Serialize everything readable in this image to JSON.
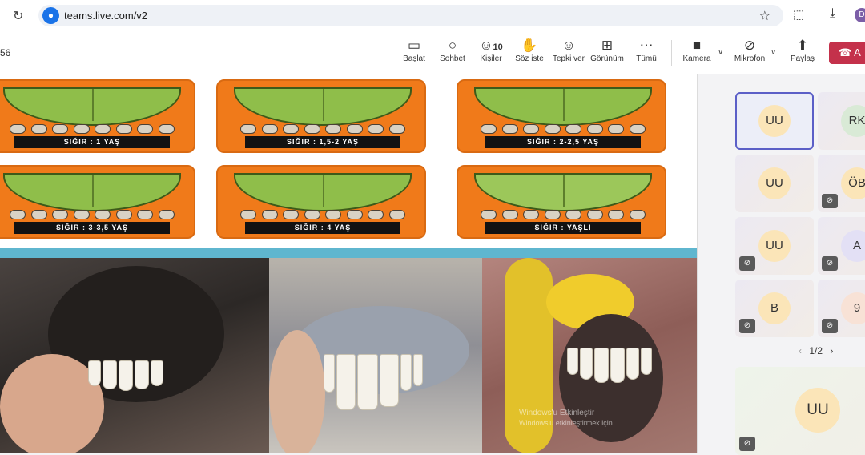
{
  "browser": {
    "url": "teams.live.com/v2",
    "avatar_letter": "D"
  },
  "toolbar": {
    "timer": "56",
    "buttons": [
      {
        "label": "Başlat",
        "icon": "start-icon"
      },
      {
        "label": "Sohbet",
        "icon": "chat-icon"
      },
      {
        "label": "Kişiler",
        "icon": "people-icon",
        "count": "10"
      },
      {
        "label": "Söz iste",
        "icon": "raise-hand-icon"
      },
      {
        "label": "Tepki ver",
        "icon": "react-icon"
      },
      {
        "label": "Görünüm",
        "icon": "view-icon"
      },
      {
        "label": "Tümü",
        "icon": "more-icon"
      },
      {
        "label": "Kamera",
        "icon": "camera-off-icon"
      },
      {
        "label": "Mikrofon",
        "icon": "mic-off-icon"
      },
      {
        "label": "Paylaş",
        "icon": "share-icon"
      }
    ],
    "leave_label": "A",
    "leave_color": "#c4314b"
  },
  "shared_content": {
    "cards": [
      {
        "caption": "SIĞIR : 1 YAŞ"
      },
      {
        "caption": "SIĞIR : 1,5-2 YAŞ"
      },
      {
        "caption": "SIĞIR : 2-2,5 YAŞ"
      },
      {
        "caption": "SIĞIR : 3-3,5 YAŞ"
      },
      {
        "caption": "SIĞIR : 4 YAŞ"
      },
      {
        "caption": "SIĞIR : YAŞLI"
      }
    ],
    "watermark_line1": "Windows'u Etkinleştir",
    "watermark_line2": "Windows'u etkinleştirmek için"
  },
  "participants": {
    "tiles": [
      {
        "initials": "UU",
        "muted": false,
        "selected": true
      },
      {
        "initials": "RK",
        "muted": false,
        "selected": false
      },
      {
        "initials": "UU",
        "muted": false,
        "selected": false
      },
      {
        "initials": "ÖB",
        "muted": true,
        "selected": false
      },
      {
        "initials": "UU",
        "muted": true,
        "selected": false
      },
      {
        "initials": "A",
        "muted": true,
        "selected": false
      },
      {
        "initials": "B",
        "muted": true,
        "selected": false
      },
      {
        "initials": "9",
        "muted": true,
        "selected": false
      }
    ],
    "pager": "1/2",
    "self_initials": "UU"
  }
}
